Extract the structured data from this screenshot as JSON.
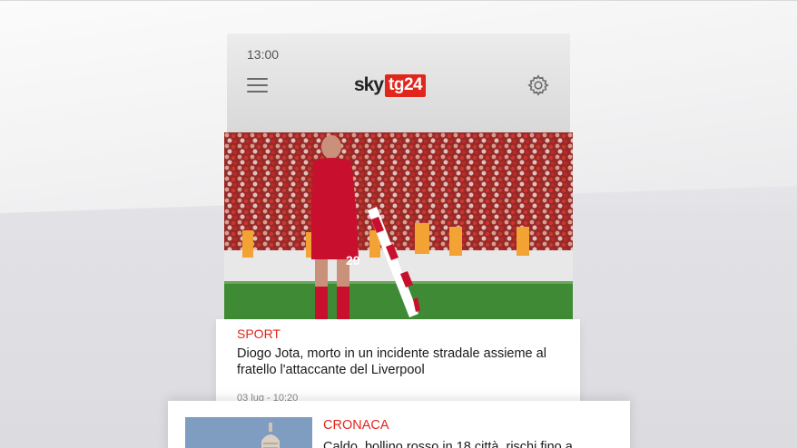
{
  "status_bar": {
    "time": "13:00"
  },
  "header": {
    "logo_sky": "sky",
    "logo_tg": "tg24",
    "menu_icon": "hamburger-menu-icon",
    "settings_icon": "gear-icon"
  },
  "articles": [
    {
      "category": "SPORT",
      "title": "Diogo Jota, morto in un incidente stradale assieme al fratello l'attaccante del Liverpool",
      "date": "03 lug - 10:20",
      "image_number": "20"
    },
    {
      "category": "CRONACA",
      "title": "Caldo, bollino rosso in 18 città, rischi fino a"
    }
  ],
  "colors": {
    "accent": "#e1261c",
    "header_bg": "#dcdcdc",
    "text": "#1a1a1a"
  }
}
